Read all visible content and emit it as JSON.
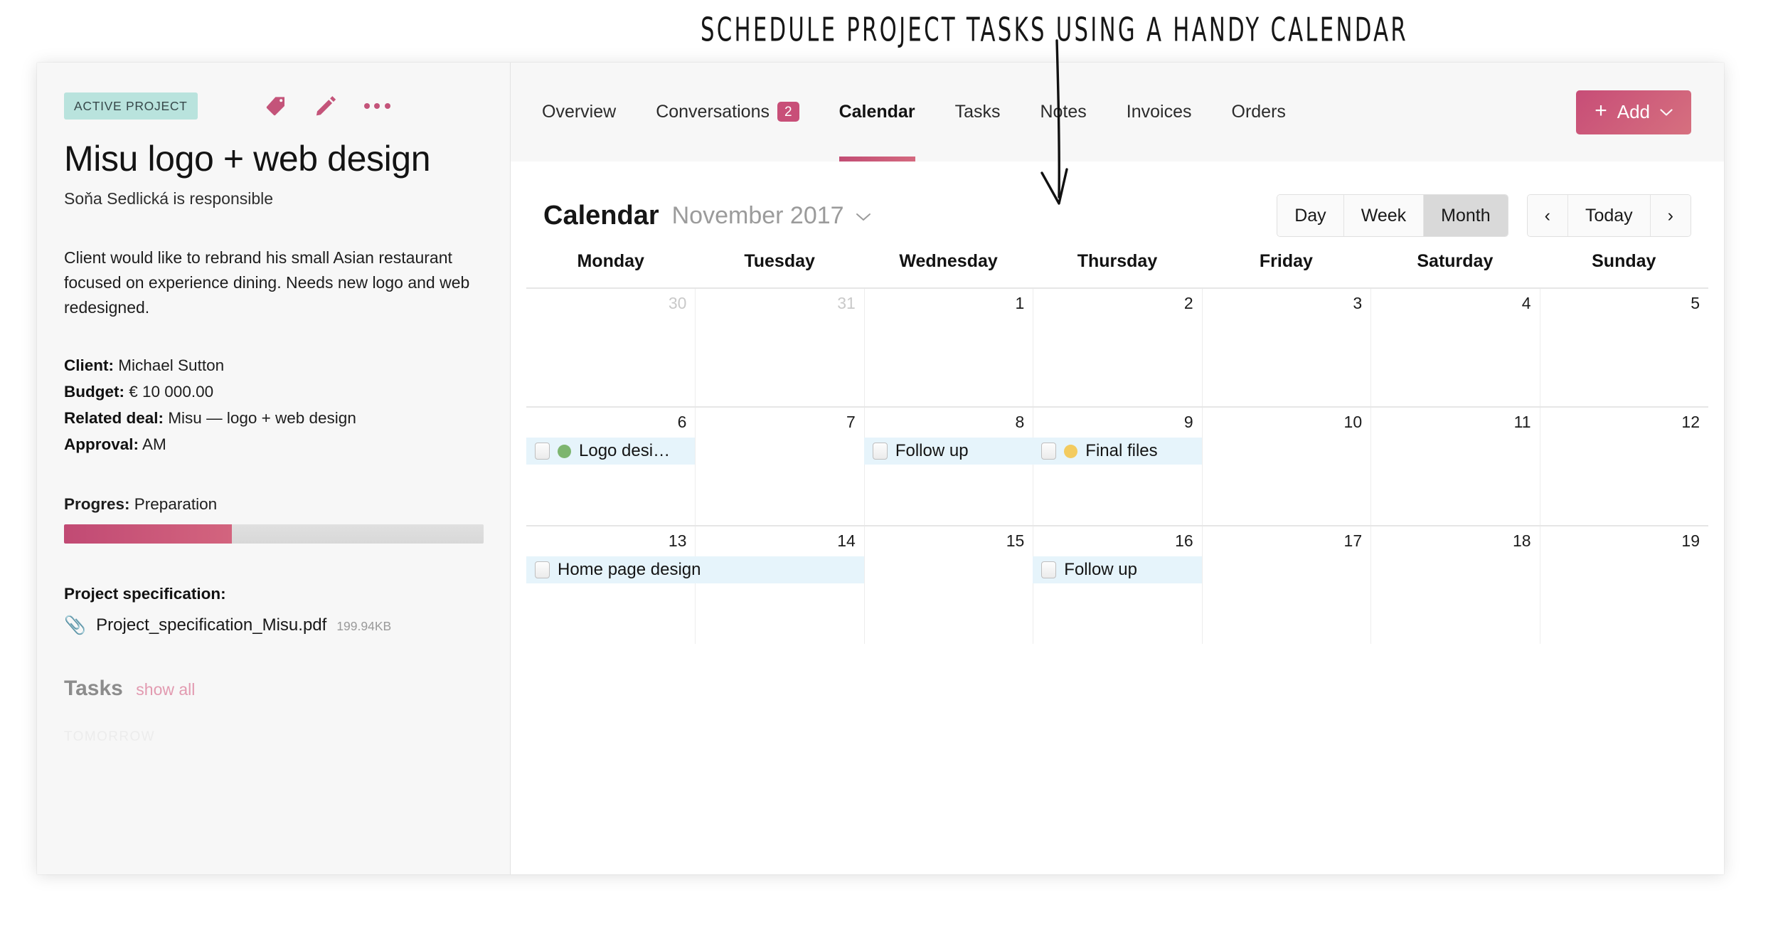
{
  "annotation": {
    "text": "SCHEDULE PROJECT TASKS USING A HANDY CALENDAR",
    "arrow": "down-arrow"
  },
  "sidebar": {
    "status_badge": "ACTIVE PROJECT",
    "icons": [
      "tag-icon",
      "pencil-icon",
      "more-options-icon"
    ],
    "title": "Misu  logo + web design",
    "owner": "Soňa Sedlická is responsible",
    "description": "Client would like to rebrand his small Asian restaurant focused on experience dining. Needs new logo and web redesigned.",
    "meta": [
      {
        "label": "Client:",
        "value": "Michael Sutton"
      },
      {
        "label": "Budget:",
        "value": "€ 10 000.00"
      },
      {
        "label": "Related deal:",
        "value": "Misu — logo + web design"
      },
      {
        "label": "Approval:",
        "value": "AM"
      }
    ],
    "progress": {
      "label": "Progres:",
      "value": "Preparation",
      "percent": 40,
      "fill_color": "#c14a74"
    },
    "specification": {
      "title": "Project specification:",
      "file_name": "Project_specification_Misu.pdf",
      "file_size": "199.94KB",
      "icon": "paperclip-icon"
    },
    "tasks": {
      "title": "Tasks",
      "show_all": "show all",
      "group_label": "TOMORROW"
    }
  },
  "tabs": [
    {
      "label": "Overview",
      "badge": null,
      "active": false
    },
    {
      "label": "Conversations",
      "badge": "2",
      "active": false
    },
    {
      "label": "Calendar",
      "badge": null,
      "active": true
    },
    {
      "label": "Tasks",
      "badge": null,
      "active": false
    },
    {
      "label": "Notes",
      "badge": null,
      "active": false
    },
    {
      "label": "Invoices",
      "badge": null,
      "active": false
    },
    {
      "label": "Orders",
      "badge": null,
      "active": false
    }
  ],
  "add_button": {
    "label": "Add",
    "plus": "+",
    "caret": "⌄"
  },
  "calendar": {
    "title": "Calendar",
    "month_label": "November 2017",
    "caret_icon": "chevron-down-icon",
    "views": [
      {
        "label": "Day",
        "active": false
      },
      {
        "label": "Week",
        "active": false
      },
      {
        "label": "Month",
        "active": true
      }
    ],
    "nav": {
      "prev": "‹",
      "today": "Today",
      "next": "›"
    },
    "weekdays": [
      "Monday",
      "Tuesday",
      "Wednesday",
      "Thursday",
      "Friday",
      "Saturday",
      "Sunday"
    ],
    "weeks": [
      {
        "days": [
          {
            "num": "30",
            "muted": true
          },
          {
            "num": "31",
            "muted": true
          },
          {
            "num": "1",
            "muted": false
          },
          {
            "num": "2",
            "muted": false
          },
          {
            "num": "3",
            "muted": false
          },
          {
            "num": "4",
            "muted": false
          },
          {
            "num": "5",
            "muted": false
          }
        ],
        "events": []
      },
      {
        "days": [
          {
            "num": "6",
            "muted": false
          },
          {
            "num": "7",
            "muted": false
          },
          {
            "num": "8",
            "muted": false
          },
          {
            "num": "9",
            "muted": false
          },
          {
            "num": "10",
            "muted": false
          },
          {
            "num": "11",
            "muted": false
          },
          {
            "num": "12",
            "muted": false
          }
        ],
        "events": [
          {
            "label": "Logo desi…",
            "start": 1,
            "span": 1,
            "dot": "#7db56f",
            "checkbox": true
          },
          {
            "label": "Follow up",
            "start": 3,
            "span": 1,
            "dot": null,
            "checkbox": true
          },
          {
            "label": "Final files",
            "start": 4,
            "span": 1,
            "dot": "#f3cb5f",
            "checkbox": true
          }
        ]
      },
      {
        "days": [
          {
            "num": "13",
            "muted": false
          },
          {
            "num": "14",
            "muted": false
          },
          {
            "num": "15",
            "muted": false
          },
          {
            "num": "16",
            "muted": false
          },
          {
            "num": "17",
            "muted": false
          },
          {
            "num": "18",
            "muted": false
          },
          {
            "num": "19",
            "muted": false
          }
        ],
        "events": [
          {
            "label": "Home page design",
            "start": 1,
            "span": 2,
            "dot": null,
            "checkbox": true
          },
          {
            "label": "Follow up",
            "start": 4,
            "span": 1,
            "dot": null,
            "checkbox": true
          }
        ]
      }
    ]
  },
  "colors": {
    "accent": "#c84f78",
    "badge_bg": "#b9e3dd",
    "event_bg": "#e6f4fb",
    "green_dot": "#7db56f",
    "yellow_dot": "#f3cb5f"
  }
}
